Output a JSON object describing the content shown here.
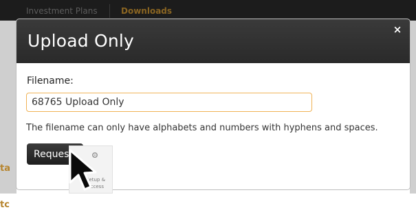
{
  "background": {
    "nav_tabs": [
      "Investment Plans",
      "Downloads"
    ],
    "fragment_1": "ta",
    "fragment_2": "tc"
  },
  "modal": {
    "title": "Upload Only",
    "close_glyph": "×",
    "filename_label": "Filename:",
    "filename_value": "68765 Upload Only",
    "help_text": "The filename can only have alphabets and numbers with hyphens and spaces.",
    "request_button_label": "Request"
  },
  "setup_tile": {
    "label": "Setup & Access",
    "icon": "gear-icon"
  },
  "cursor": {
    "icon": "arrow-cursor-icon"
  },
  "colors": {
    "modal_header": "#2e2e2e",
    "input_border": "#f0b255",
    "accent_tab": "#8a6522"
  }
}
